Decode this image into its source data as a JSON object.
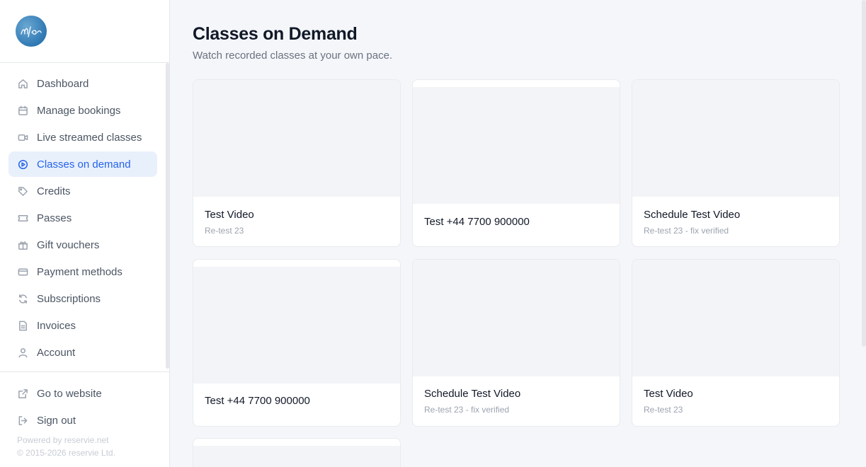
{
  "brand": {
    "logo_text": "reservie",
    "color": "#3a82bd"
  },
  "sidebar": {
    "items": [
      {
        "label": "Dashboard",
        "icon": "home-icon"
      },
      {
        "label": "Manage bookings",
        "icon": "calendar-icon"
      },
      {
        "label": "Live streamed classes",
        "icon": "video-camera-icon"
      },
      {
        "label": "Classes on demand",
        "icon": "play-circle-icon",
        "active": true
      },
      {
        "label": "Credits",
        "icon": "tag-icon"
      },
      {
        "label": "Passes",
        "icon": "ticket-icon"
      },
      {
        "label": "Gift vouchers",
        "icon": "gift-icon"
      },
      {
        "label": "Payment methods",
        "icon": "credit-card-icon"
      },
      {
        "label": "Subscriptions",
        "icon": "refresh-icon"
      },
      {
        "label": "Invoices",
        "icon": "document-icon"
      },
      {
        "label": "Account",
        "icon": "user-icon"
      }
    ],
    "bottom": [
      {
        "label": "Go to website",
        "icon": "external-link-icon"
      },
      {
        "label": "Sign out",
        "icon": "sign-out-icon"
      }
    ],
    "powered_by": "Powered by reservie.net",
    "copyright": "© 2015-2026 reservie Ltd."
  },
  "main": {
    "title": "Classes on Demand",
    "subtitle": "Watch recorded classes at your own pace.",
    "videos": [
      {
        "title": "Test Video",
        "subtitle": "Re-test 23"
      },
      {
        "title": "Test +44 7700 900000",
        "subtitle": ""
      },
      {
        "title": "Schedule Test Video",
        "subtitle": "Re-test 23 - fix verified"
      },
      {
        "title": "Test +44 7700 900000",
        "subtitle": ""
      },
      {
        "title": "Schedule Test Video",
        "subtitle": "Re-test 23 - fix verified"
      },
      {
        "title": "Test Video",
        "subtitle": "Re-test 23"
      },
      {
        "title": "",
        "subtitle": ""
      }
    ]
  },
  "colors": {
    "accent": "#2563eb",
    "active_bg": "#e8f0fc",
    "page_bg": "#f4f6f9"
  }
}
